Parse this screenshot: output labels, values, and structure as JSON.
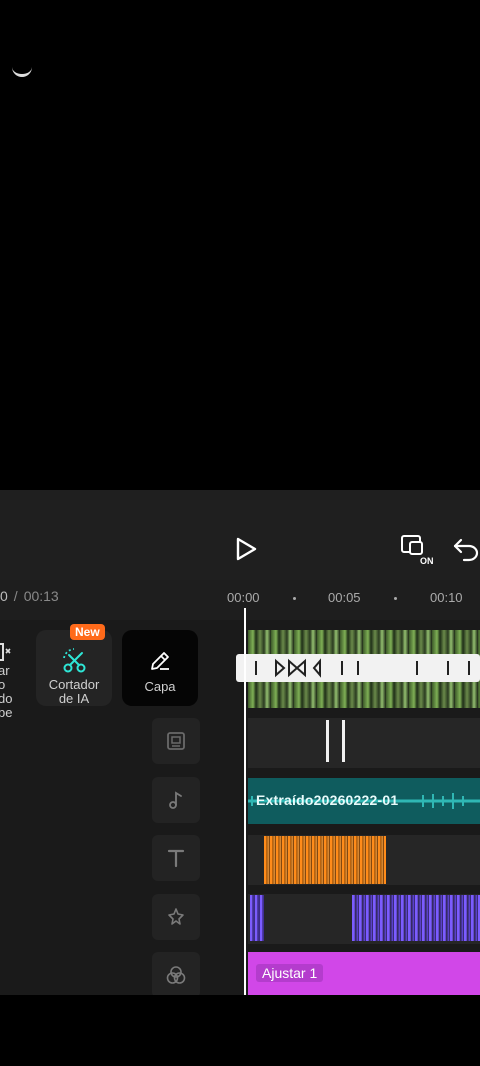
{
  "editor": {
    "time": {
      "current": "0",
      "separator": "/",
      "total": "00:13"
    },
    "ruler": {
      "labels": [
        "00:00",
        "00:05",
        "00:10"
      ]
    },
    "tools": {
      "left_partial": {
        "line1": "ar",
        "line2": "o do",
        "line3": "be"
      },
      "ai_cutter": {
        "line1": "Cortador",
        "line2": "de IA",
        "badge": "New"
      },
      "cover": {
        "label": "Capa"
      }
    },
    "tracks": {
      "audio": {
        "label": "Extraído20260222-01",
        "color": "#0f5c5e"
      },
      "adjust": {
        "label": "Ajustar 1",
        "color": "#d147e8"
      }
    },
    "colors": {
      "accent": "#2ee6d6",
      "badge": "#ff6a1a"
    },
    "icons": [
      "play-icon",
      "aspect-on-icon",
      "undo-icon",
      "scissors-ai-icon",
      "pencil-icon",
      "sticker-icon",
      "music-icon",
      "text-icon",
      "effects-icon",
      "filters-icon"
    ]
  }
}
